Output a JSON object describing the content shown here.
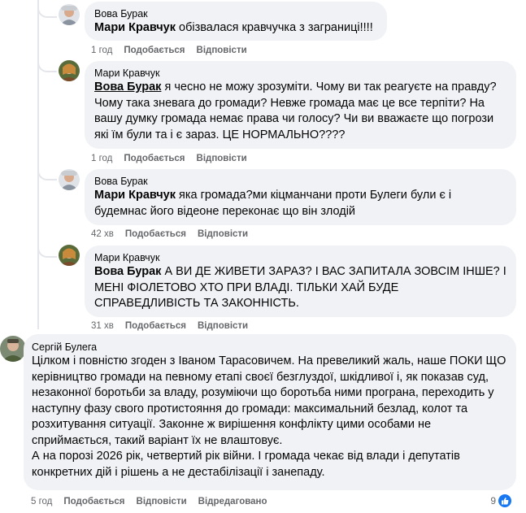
{
  "colors": {
    "bubble": "#f0f2f5",
    "meta_text": "#65676b",
    "like_blue": "#1877f2"
  },
  "comments": [
    {
      "author": "Вова Бурак",
      "mention": "Мари Кравчук",
      "text": " обізвалася кравчучка з заграниці!!!!",
      "time": "1 год",
      "like": "Подобається",
      "reply": "Відповісти"
    },
    {
      "author": "Мари Кравчук",
      "mention": "Вова Бурак",
      "text": " я чесно не можу зрозуміти. Чому ви так реагуєте на правду? Чому така зневага до громади? Невже громада має це все терпіти? На вашу думку громада немає права чи голосу? Чи ви вважаєте що погрози які їм були та і є зараз. ЦЕ НОРМАЛЬНО????",
      "time": "1 год",
      "like": "Подобається",
      "reply": "Відповісти"
    },
    {
      "author": "Вова Бурак",
      "mention": "Мари Кравчук",
      "text": " яка громада?ми кіцманчани проти Булеги були є і будемнас його відеоне переконає що він злодій",
      "time": "42 хв",
      "like": "Подобається",
      "reply": "Відповісти"
    },
    {
      "author": "Мари Кравчук",
      "mention": "Вова Бурак",
      "text": " А ВИ ДЕ ЖИВЕТИ ЗАРАЗ? І ВАС ЗАПИТАЛА ЗОВСІМ ІНШЕ? І МЕНІ ФІОЛЕТОВО ХТО ПРИ ВЛАДІ. ТІЛЬКИ ХАЙ БУДЕ СПРАВЕДЛИВІСТЬ ТА ЗАКОННІСТЬ.",
      "time": "31 хв",
      "like": "Подобається",
      "reply": "Відповісти"
    },
    {
      "author": "Сергій Булега",
      "text": "Цілком і повністю згоден з Іваном Тарасовичем. На превеликий жаль, наше ПОКИ ЩО керівництво громади на певному етапі своєї безглуздої, шкідливої і, як показав суд, незаконної боротьби за владу, розуміючи що боротьба ними програна, переходить у наступну фазу свого протистояння до громади: максимальний безлад, колот та розхитування ситуації. Законне ж вирішення конфлікту цими особами не сприймається, такий варіант їх не влаштовує.",
      "text2": "А на порозі 2026 рік, четвертий рік війни. І громада чекає від влади і депутатів конкретних дій і рішень а не дестабілізації і занепаду.",
      "time": "5 год",
      "like": "Подобається",
      "reply": "Відповісти",
      "edited": "Відредаговано",
      "reaction_count": "9",
      "reaction_icon": "like-icon"
    }
  ]
}
